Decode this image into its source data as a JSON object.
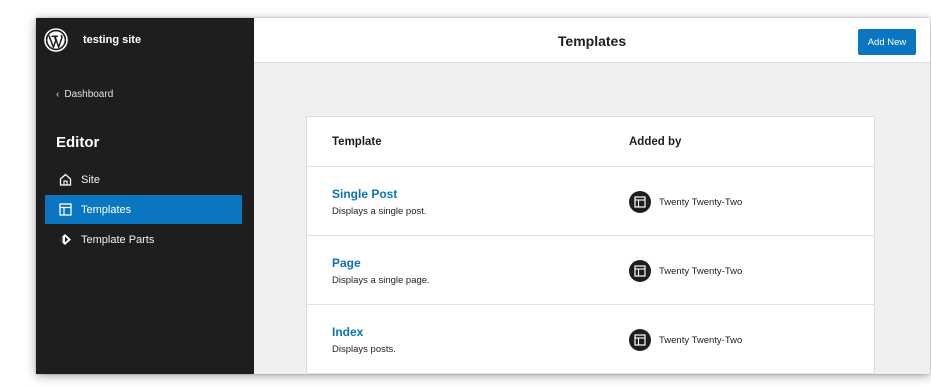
{
  "sidebar": {
    "site_title": "testing site",
    "back_label": "Dashboard",
    "section_title": "Editor",
    "items": [
      {
        "label": "Site",
        "icon": "home-icon",
        "active": false
      },
      {
        "label": "Templates",
        "icon": "layout-icon",
        "active": true
      },
      {
        "label": "Template Parts",
        "icon": "symbol-icon",
        "active": false
      }
    ]
  },
  "header": {
    "title": "Templates",
    "add_new_label": "Add New"
  },
  "table": {
    "columns": [
      "Template",
      "Added by"
    ],
    "rows": [
      {
        "title": "Single Post",
        "description": "Displays a single post.",
        "added_by": "Twenty Twenty-Two"
      },
      {
        "title": "Page",
        "description": "Displays a single page.",
        "added_by": "Twenty Twenty-Two"
      },
      {
        "title": "Index",
        "description": "Displays posts.",
        "added_by": "Twenty Twenty-Two"
      }
    ]
  },
  "colors": {
    "sidebar_bg": "#1e1e1e",
    "accent": "#0a76c2",
    "link": "#0a72b8",
    "main_bg": "#f0f0f0"
  }
}
